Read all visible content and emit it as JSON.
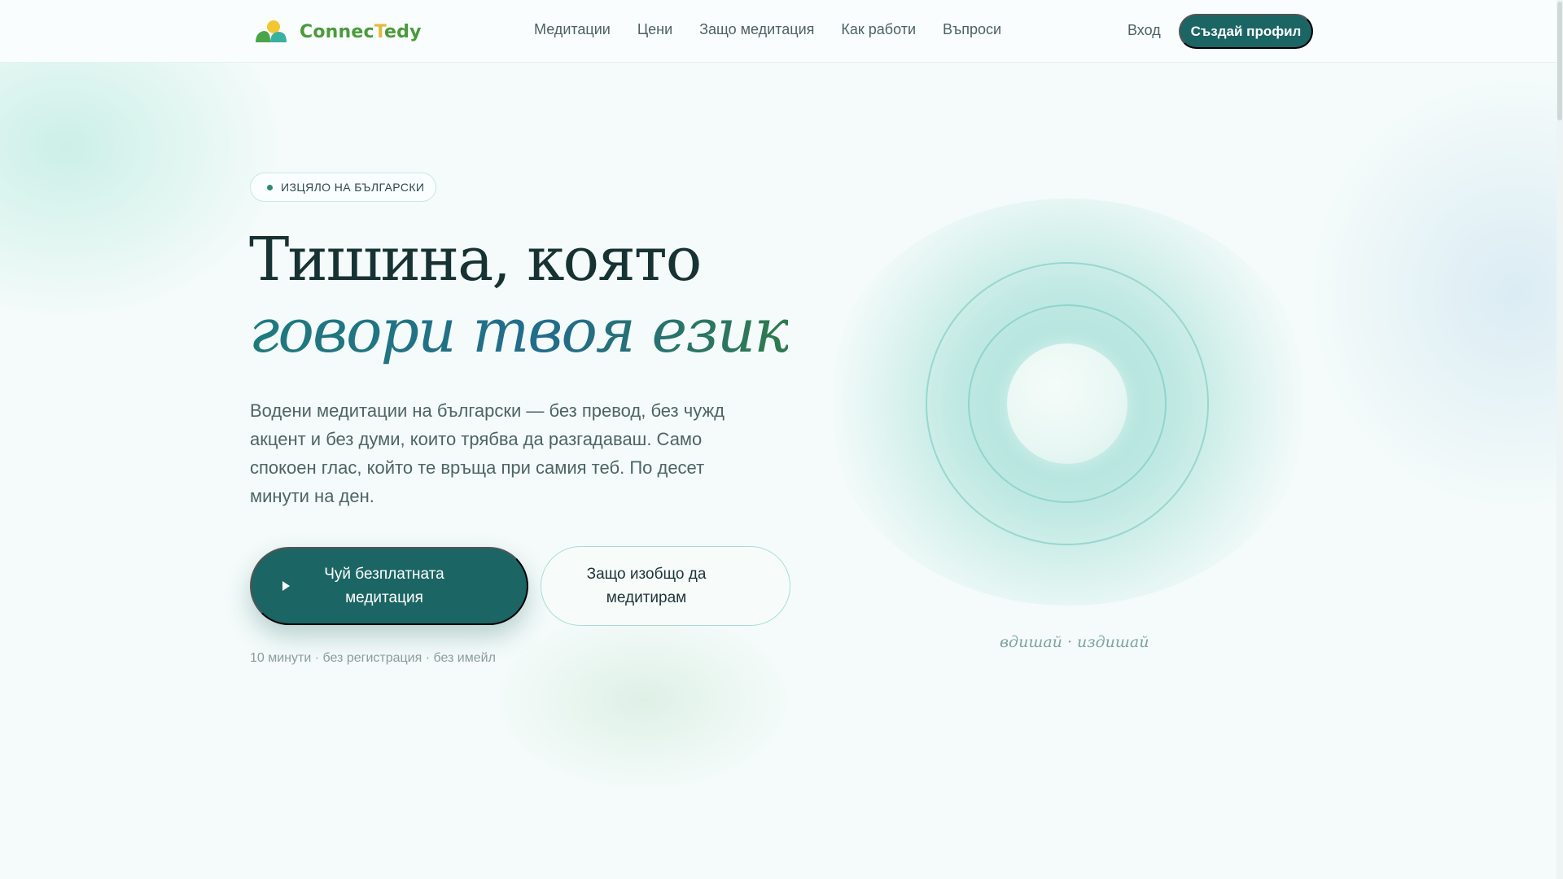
{
  "nav": {
    "logo": {
      "text_main": "Connec",
      "text_accent": "T",
      "text_tail": "edy"
    },
    "links": [
      "Медитации",
      "Цени",
      "Защо медитация",
      "Как работи",
      "Въпроси"
    ],
    "login_label": "Вход",
    "signup_label": "Създай профил"
  },
  "hero": {
    "badge": "ИЗЦЯЛО НА БЪЛГАРСКИ",
    "headline_line1": "Тишина, която",
    "headline_line2": "говори твоя език",
    "lead": "Водени медитации на български — без превод, без чужд акцент и без думи, които трябва да разгадаваш. Само спокоен глас, който те връща при самия теб. По десет минути на ден.",
    "primary_button": "Чуй безплатната медитация",
    "secondary_button": "Защо изобщо да медитирам",
    "footnote": "10 минути · без регистрация · без имейл"
  },
  "orb": {
    "caption": "вдишай · издишай"
  },
  "colors": {
    "brand": "#1c6565",
    "background": "#f4fbfa",
    "logo_green": "#4a9a3a",
    "logo_yellow": "#e5b93a"
  }
}
